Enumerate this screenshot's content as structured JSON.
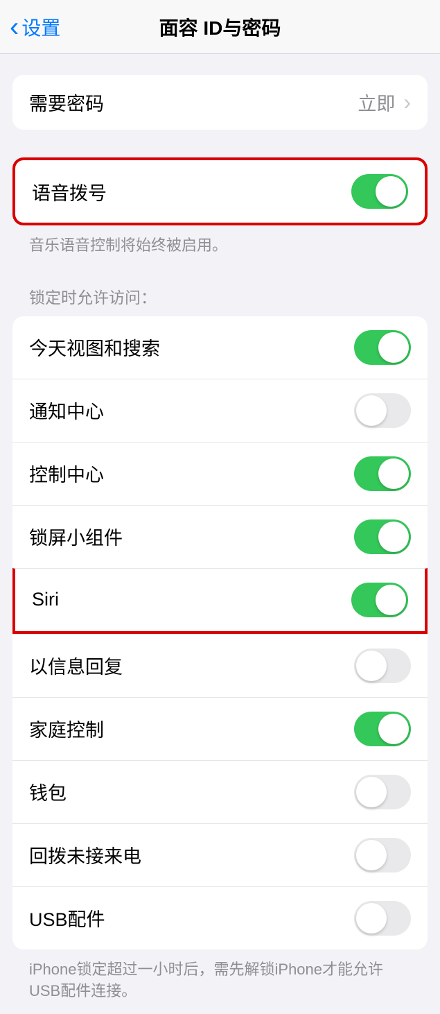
{
  "header": {
    "back_label": "设置",
    "title": "面容 ID与密码"
  },
  "require_passcode": {
    "label": "需要密码",
    "value": "立即"
  },
  "voice_dial": {
    "label": "语音拨号",
    "on": true,
    "footer": "音乐语音控制将始终被启用。"
  },
  "locked_access": {
    "header": "锁定时允许访问：",
    "items": [
      {
        "label": "今天视图和搜索",
        "on": true
      },
      {
        "label": "通知中心",
        "on": false
      },
      {
        "label": "控制中心",
        "on": true
      },
      {
        "label": "锁屏小组件",
        "on": true
      },
      {
        "label": "Siri",
        "on": true,
        "highlight": true
      },
      {
        "label": "以信息回复",
        "on": false
      },
      {
        "label": "家庭控制",
        "on": true
      },
      {
        "label": "钱包",
        "on": false
      },
      {
        "label": "回拨未接来电",
        "on": false
      },
      {
        "label": "USB配件",
        "on": false
      }
    ],
    "footer": "iPhone锁定超过一小时后，需先解锁iPhone才能允许USB配件连接。"
  }
}
